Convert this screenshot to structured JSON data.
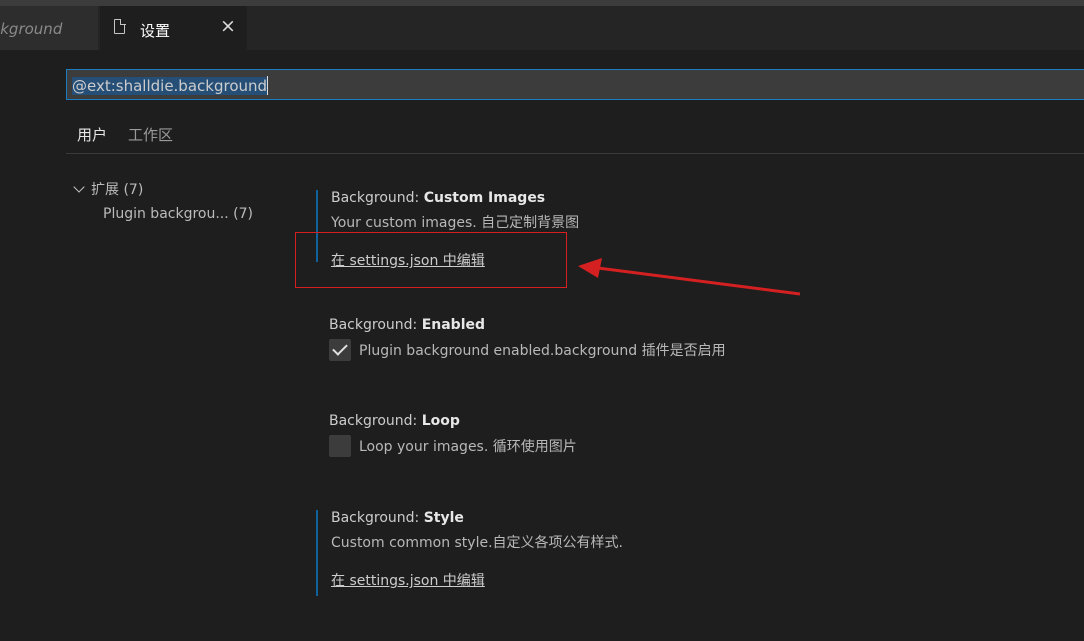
{
  "tabs": [
    {
      "label": "ckground"
    },
    {
      "label": "设置",
      "close": "×"
    }
  ],
  "search": {
    "query": "@ext:shalldie.background"
  },
  "scopes": {
    "user": "用户",
    "workspace": "工作区"
  },
  "toc": {
    "group_label": "扩展 (7)",
    "item_label": "Plugin backgrou... (7)"
  },
  "settings": [
    {
      "category": "Background: ",
      "name": "Custom Images",
      "description": "Your custom images. 自己定制背景图",
      "link": "在 settings.json 中编辑"
    },
    {
      "category": "Background: ",
      "name": "Enabled",
      "checkbox_label": "Plugin background enabled.background 插件是否启用",
      "checked": true
    },
    {
      "category": "Background: ",
      "name": "Loop",
      "checkbox_label": "Loop your images. 循环使用图片",
      "checked": false
    },
    {
      "category": "Background: ",
      "name": "Style",
      "description": "Custom common style.自定义各项公有样式.",
      "link": "在 settings.json 中编辑"
    }
  ],
  "annotation": {
    "color": "#d42020"
  }
}
